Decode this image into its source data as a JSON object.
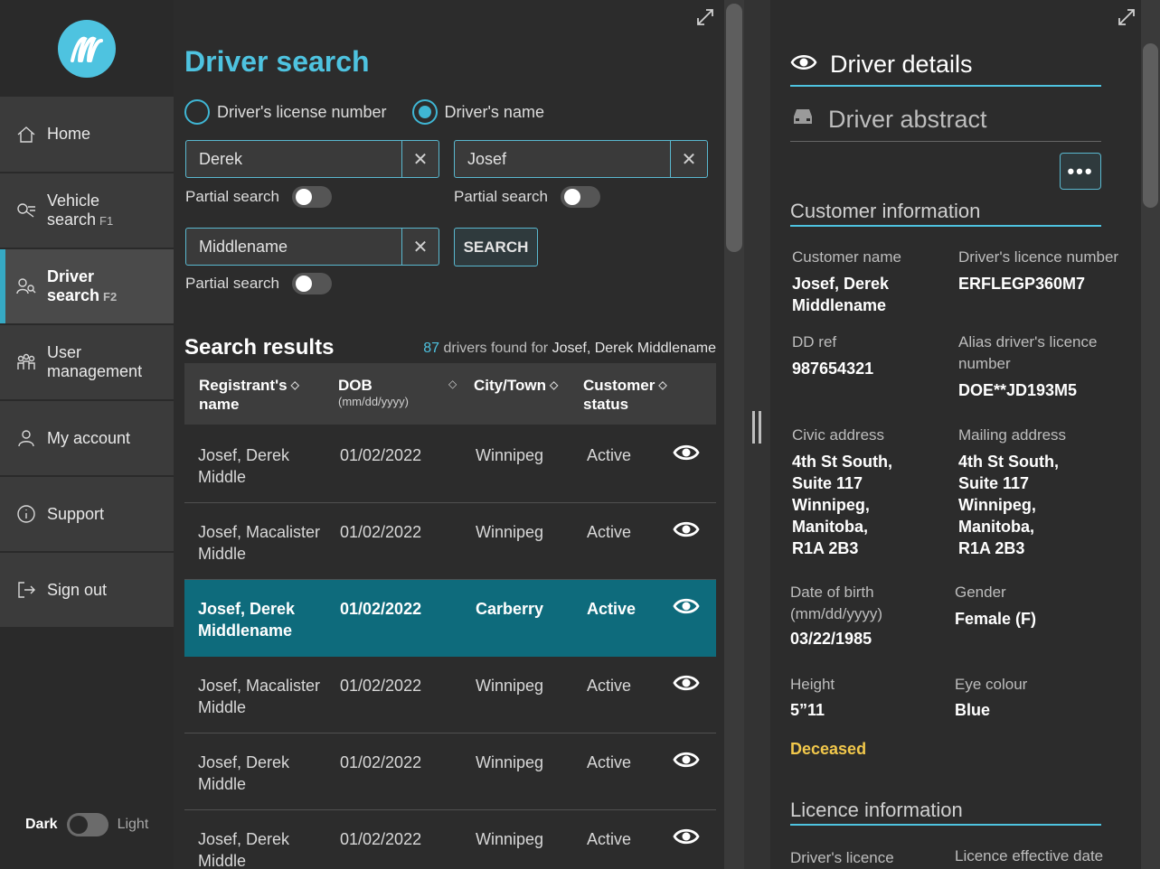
{
  "sidebar": {
    "items": [
      {
        "label": "Home",
        "shortcut": "",
        "icon": "home-icon"
      },
      {
        "label": "Vehicle",
        "label2": "search",
        "shortcut": "F1",
        "icon": "car-search-icon"
      },
      {
        "label": "Driver",
        "label2": "search",
        "shortcut": "F2",
        "icon": "driver-search-icon"
      },
      {
        "label": "User",
        "label2": "management",
        "shortcut": "",
        "icon": "users-icon"
      },
      {
        "label": "My account",
        "shortcut": "",
        "icon": "user-icon"
      },
      {
        "label": "Support",
        "shortcut": "",
        "icon": "info-icon"
      },
      {
        "label": "Sign out",
        "shortcut": "",
        "icon": "sign-out-icon"
      }
    ],
    "theme": {
      "dark": "Dark",
      "light": "Light"
    }
  },
  "search": {
    "title": "Driver search",
    "radio_license": "Driver's license number",
    "radio_name": "Driver's name",
    "first_name": "Derek",
    "last_name": "Josef",
    "middle_name": "Middlename",
    "partial_label": "Partial search",
    "search_button": "SEARCH"
  },
  "results": {
    "title": "Search results",
    "count": "87",
    "found_text": "drivers found for",
    "query": "Josef, Derek Middlename",
    "columns": {
      "name": "Registrant's",
      "name2": "name",
      "dob": "DOB",
      "dob_sub": "(mm/dd/yyyy)",
      "city": "City/Town",
      "status": "Customer",
      "status2": "status"
    },
    "rows": [
      {
        "name1": "Josef, Derek",
        "name2": "Middle",
        "dob": "01/02/2022",
        "city": "Winnipeg",
        "status": "Active"
      },
      {
        "name1": "Josef, Macalister",
        "name2": "Middle",
        "dob": "01/02/2022",
        "city": "Winnipeg",
        "status": "Active"
      },
      {
        "name1": "Josef, Derek",
        "name2": "Middlename",
        "dob": "01/02/2022",
        "city": "Carberry",
        "status": "Active"
      },
      {
        "name1": "Josef, Macalister",
        "name2": "Middle",
        "dob": "01/02/2022",
        "city": "Winnipeg",
        "status": "Active"
      },
      {
        "name1": "Josef, Derek",
        "name2": "Middle",
        "dob": "01/02/2022",
        "city": "Winnipeg",
        "status": "Active"
      },
      {
        "name1": "Josef, Derek",
        "name2": "Middle",
        "dob": "01/02/2022",
        "city": "Winnipeg",
        "status": "Active"
      }
    ]
  },
  "details": {
    "tab_details": "Driver details",
    "tab_abstract": "Driver abstract",
    "more_button": "•••",
    "customer_section": "Customer information",
    "customer_name_label": "Customer name",
    "customer_name_1": "Josef, Derek",
    "customer_name_2": "Middlename",
    "licence_number_label": "Driver's licence number",
    "licence_number": "ERFLEGP360M7",
    "dd_ref_label": "DD ref",
    "dd_ref": "987654321",
    "alias_label_1": "Alias driver's licence",
    "alias_label_2": "number",
    "alias": "DOE**JD193M5",
    "civic_label": "Civic address",
    "civic": [
      "4th St South,",
      "Suite 117",
      "Winnipeg,",
      "Manitoba,",
      "R1A 2B3"
    ],
    "mailing_label": "Mailing address",
    "mailing": [
      "4th St South,",
      "Suite 117",
      "Winnipeg,",
      "Manitoba,",
      "R1A 2B3"
    ],
    "dob_label": "Date of birth",
    "dob_sub": "(mm/dd/yyyy)",
    "dob": "03/22/1985",
    "gender_label": "Gender",
    "gender": "Female (F)",
    "height_label": "Height",
    "height": "5”11",
    "eye_label": "Eye colour",
    "eye": "Blue",
    "deceased": "Deceased",
    "licence_section": "Licence information",
    "licence_label": "Driver's licence",
    "effective_label": "Licence effective date"
  },
  "colors": {
    "accent": "#4ec3e0",
    "selected_row": "#0e6b7c",
    "deceased": "#f2c84b"
  }
}
